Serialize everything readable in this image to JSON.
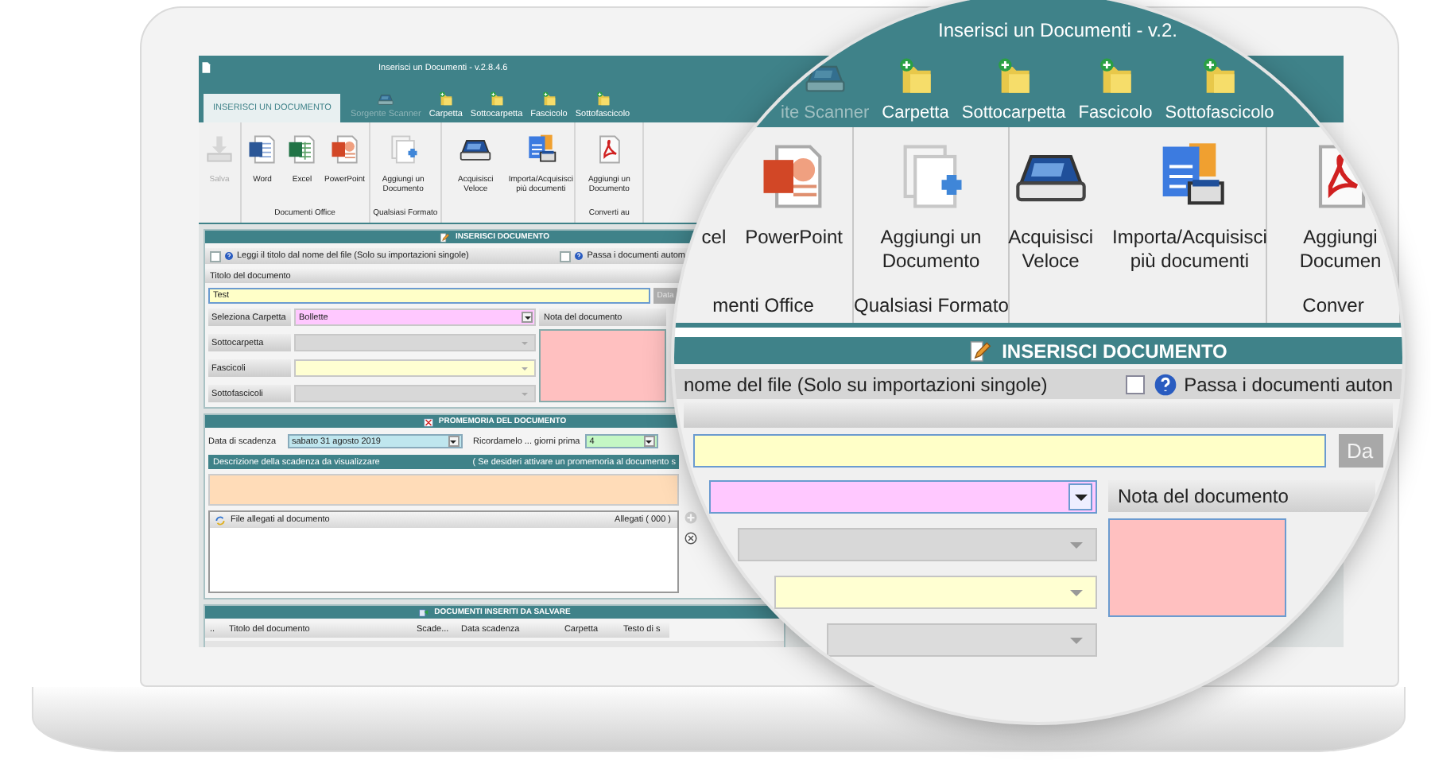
{
  "screen": {
    "title": "Inserisci un Documenti - v.2.8.4.6",
    "tabs": [
      {
        "label": "INSERISCI UN DOCUMENTO",
        "selected": true
      }
    ],
    "toolbar": [
      {
        "label": "Sorgente Scanner",
        "kind": "scanner",
        "disabled": true
      },
      {
        "label": "Carpetta",
        "kind": "folder",
        "disabled": false
      },
      {
        "label": "Sottocarpetta",
        "kind": "folder",
        "disabled": false
      },
      {
        "label": "Fascicolo",
        "kind": "folder",
        "disabled": false
      },
      {
        "label": "Sottofascicolo",
        "kind": "folder",
        "disabled": false
      }
    ],
    "ribbon_groups": [
      {
        "buttons": [
          {
            "label": "Salva",
            "kind": "save",
            "disabled": true
          }
        ]
      },
      {
        "label": "Documenti Office",
        "buttons": [
          {
            "label": "Word",
            "kind": "word",
            "disabled": false
          },
          {
            "label": "Excel",
            "kind": "excel",
            "disabled": false
          },
          {
            "label": "PowerPoint",
            "kind": "powerpoint",
            "disabled": false
          }
        ]
      },
      {
        "label": "Qualsiasi Formato",
        "buttons": [
          {
            "label": "Aggiungi un Documento",
            "kind": "add",
            "disabled": false
          }
        ]
      },
      {
        "buttons": [
          {
            "label": "Acquisisci Veloce",
            "kind": "scanner",
            "disabled": false
          },
          {
            "label": "Importa/Acquisisci più documenti",
            "kind": "import",
            "disabled": false
          }
        ]
      },
      {
        "label": "Converti au",
        "buttons": [
          {
            "label": "Aggiungi un Documento",
            "kind": "pdf",
            "disabled": false
          }
        ]
      }
    ],
    "insert_section": {
      "header": "INSERISCI DOCUMENTO",
      "options": [
        {
          "label": "Leggi il titolo dal nome del file (Solo su importazioni singole)",
          "checked": false
        },
        {
          "label": "Passa i documenti autom",
          "checked": false
        }
      ],
      "title_label": "Titolo del documento",
      "title_value": "Test",
      "date_button": "Data",
      "fields": [
        {
          "label": "Seleziona Carpetta",
          "value": "Bollette",
          "color": "#ffc8ff"
        },
        {
          "label": "Sottocarpetta",
          "color": "#d8d8d8"
        },
        {
          "label": "Fascicoli",
          "color": "#ffffd2"
        },
        {
          "label": "Sottofascicoli",
          "color": "#d8d8d8"
        }
      ],
      "note_label": "Nota del documento"
    },
    "reminder_section": {
      "header": "PROMEMORIA DEL DOCUMENTO",
      "due_label": "Data di scadenza",
      "due_value": "sabato 31 agosto 2019",
      "remind_label": "Ricordamelo ... giorni prima",
      "remind_value": "4",
      "description_label": "Descrizione della scadenza da visualizzare",
      "description_hint": "( Se desideri attivare un promemoria al documento s",
      "attachments_label": "File allegati al documento",
      "attachments_count": "Allegati ( 000 )",
      "attachment_buttons": [
        {
          "kind": "add",
          "disabled": true
        },
        {
          "kind": "remove",
          "disabled": false
        }
      ]
    },
    "documents_section": {
      "header": "DOCUMENTI INSERITI DA SALVARE",
      "columns": [
        "..",
        "Titolo del documento",
        "Scade...",
        "Data scadenza",
        "Carpetta",
        "Testo di s"
      ]
    }
  },
  "magnifier": {
    "title": "Inserisci un Documenti - v.2.",
    "toolbar": [
      {
        "label": "ite Scanner",
        "kind": "scanner",
        "disabled": true
      },
      {
        "label": "Carpetta",
        "kind": "folder",
        "disabled": false
      },
      {
        "label": "Sottocarpetta",
        "kind": "folder",
        "disabled": false
      },
      {
        "label": "Fascicolo",
        "kind": "folder",
        "disabled": false
      },
      {
        "label": "Sottofascicolo",
        "kind": "folder",
        "disabled": false
      }
    ],
    "ribbon_groups": [
      {
        "label": "menti Office",
        "buttons": [
          {
            "label": "cel"
          },
          {
            "label": "PowerPoint",
            "kind": "powerpoint"
          }
        ]
      },
      {
        "label": "Qualsiasi Formato",
        "buttons": [
          {
            "label": "Aggiungi un Documento",
            "kind": "add"
          }
        ]
      },
      {
        "buttons": [
          {
            "label": "Acquisisci Veloce",
            "kind": "scanner"
          },
          {
            "label": "Importa/Acquisisci più documenti",
            "kind": "import"
          }
        ]
      },
      {
        "label": "Conver",
        "buttons": [
          {
            "label": "Aggiungi Documen",
            "kind": "pdf"
          }
        ]
      }
    ],
    "header": "INSERISCI DOCUMENTO",
    "option_text": "nome del file (Solo su importazioni singole)",
    "option": {
      "label": "Passa i documenti auton",
      "checked": false
    },
    "date_button": "Da",
    "fields": [
      {
        "color": "#ffc8ff"
      },
      {
        "color": "#d8d8d8"
      },
      {
        "color": "#ffffd2"
      },
      {
        "color": "#dcdcdc"
      }
    ],
    "note_label": "Nota del documento"
  }
}
